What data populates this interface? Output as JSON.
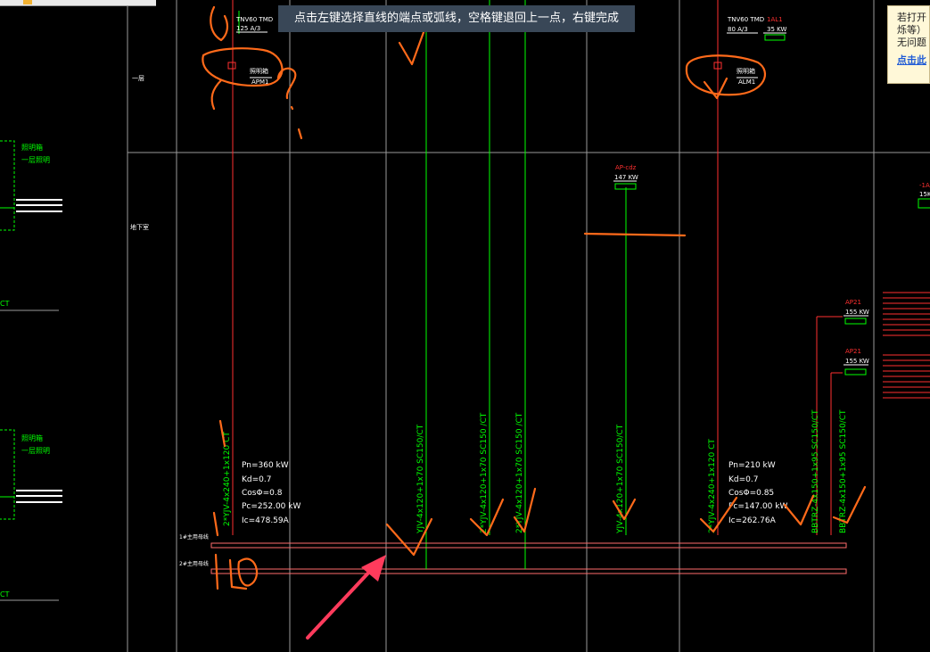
{
  "tooltip": {
    "text": "点击左键选择直线的端点或弧线，空格键退回上一点，右键完成"
  },
  "notice": {
    "line1": "若打开",
    "line2": "烁等）",
    "line3": "无问题",
    "link": "点击此"
  },
  "floors": {
    "first": "一层",
    "basement": "地下室"
  },
  "top_labels": {
    "left_breaker": "TNV60 TMD",
    "left_rating": "125 A/3",
    "left_box": "照明箱",
    "left_box_id": "APM1",
    "right_breaker": "TNV60 TMD",
    "right_rating": "80 A/3",
    "right_id": "1AL1",
    "right_power": "35 KW",
    "right_box": "照明箱",
    "right_box_id": "ALM1"
  },
  "ap_cdz": {
    "id": "AP-cdz",
    "power": "147 KW"
  },
  "ap_right": [
    {
      "id": "AP21",
      "power": "155 KW"
    },
    {
      "id": "AP21",
      "power": "155 KW"
    }
  ],
  "edge_right": {
    "id": "-1A",
    "power": "15K"
  },
  "left_panels": [
    {
      "title": "照明箱",
      "sub": "一层照明",
      "ct": "CT"
    },
    {
      "title": "照明箱",
      "sub": "一层照明",
      "ct": "CT"
    }
  ],
  "calc_left": {
    "pn": "Pn=360 kW",
    "kd": "Kd=0.7",
    "cos": "CosΦ=0.8",
    "pc": "Pc=252.00 kW",
    "ic": "Ic=478.59A"
  },
  "calc_right": {
    "pn": "Pn=210 kW",
    "kd": "Kd=0.7",
    "cos": "CosΦ=0.85",
    "pc": "Pc=147.00 kW",
    "ic": "Ic=262.76A"
  },
  "cables": [
    "2*YJV-4x240+1x120 CT",
    "YJV-4x120+1x70  SC150/CT",
    "2*YJV-4x120+1x70  SC150 /CT",
    "2*YJV-4x120+1x70  SC150 /CT",
    "YJV-4x120+1x70  SC150/CT",
    "2*YJV-4x240+1x120 CT",
    "BBTRZ-4x150+1x95  SC150/CT",
    "BBTRZ-4x150+1x95  SC150/CT"
  ],
  "bus_labels": [
    "1#主用母线",
    "2#主用母线"
  ],
  "colors": {
    "background": "#000000",
    "cad_white": "#ffffff",
    "cad_green": "#00ff00",
    "cad_red": "#ff3030",
    "annotation": "#ff6a1a",
    "arrow": "#ff3b5c"
  }
}
